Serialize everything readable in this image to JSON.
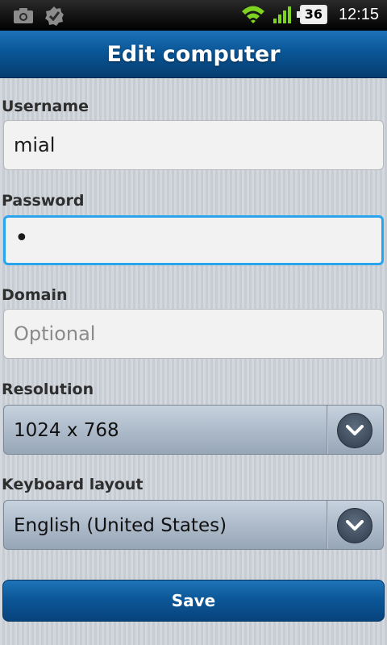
{
  "status_bar": {
    "time": "12:15",
    "battery_level": "36",
    "icons": [
      "camera-icon",
      "checkmark-badge-icon",
      "wifi-icon",
      "signal-icon",
      "battery-icon"
    ]
  },
  "title": "Edit computer",
  "form": {
    "username": {
      "label": "Username",
      "value": "mial"
    },
    "password": {
      "label": "Password",
      "value": "•"
    },
    "domain": {
      "label": "Domain",
      "placeholder": "Optional"
    },
    "resolution": {
      "label": "Resolution",
      "selected": "1024 x 768"
    },
    "keyboard_layout": {
      "label": "Keyboard layout",
      "selected": "English (United States)"
    }
  },
  "save_label": "Save",
  "colors": {
    "title_bar": "#0a5697",
    "focus_border": "#29a5ee",
    "wifi_green": "#7ed321"
  }
}
